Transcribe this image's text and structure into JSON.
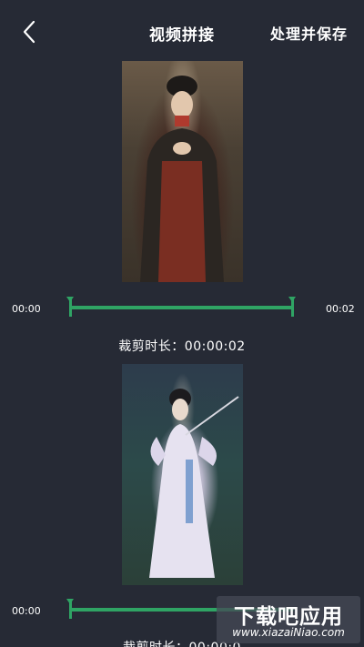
{
  "header": {
    "back_icon": "chevron-left-icon",
    "title": "视频拼接",
    "save_label": "处理并保存"
  },
  "clips": [
    {
      "start_time": "00:00",
      "end_time": "00:02",
      "duration_text": "裁剪时长：00:00:02",
      "trim_start": 0.0,
      "trim_end": 1.0
    },
    {
      "start_time": "00:00",
      "end_time": "",
      "duration_text": "裁剪时长：00:00:0",
      "trim_start": 0.0,
      "trim_end": 1.0
    }
  ],
  "watermark": {
    "title": "下载吧应用",
    "url": "www.xiazaiNiao.com"
  },
  "colors": {
    "background": "#262a35",
    "accent": "#2fa464",
    "text": "#ffffff"
  }
}
